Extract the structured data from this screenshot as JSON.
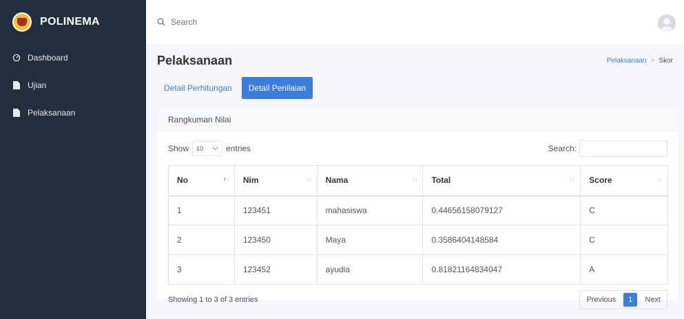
{
  "brand": {
    "name": "POLINEMA",
    "logo_icon": "polinema-logo-icon"
  },
  "sidebar": {
    "items": [
      {
        "label": "Dashboard",
        "icon": "dashboard-icon"
      },
      {
        "label": "Ujian",
        "icon": "file-icon"
      },
      {
        "label": "Pelaksanaan",
        "icon": "file-icon"
      }
    ]
  },
  "topbar": {
    "search_placeholder": "Search",
    "avatar_icon": "user-avatar"
  },
  "page": {
    "title": "Pelaksanaan",
    "breadcrumb": {
      "link": "Pelaksanaan",
      "separator": ">",
      "current": "Skor"
    }
  },
  "tabs": [
    {
      "label": "Detail Perhitungan",
      "active": false
    },
    {
      "label": "Detail Penilaian",
      "active": true
    }
  ],
  "card": {
    "header": "Rangkuman Nilai",
    "length": {
      "show": "Show",
      "value": "10",
      "entries": "entries"
    },
    "search_label": "Search:",
    "columns": [
      "No",
      "Nim",
      "Nama",
      "Total",
      "Score"
    ],
    "rows": [
      [
        "1",
        "123451",
        "mahasiswa",
        "0.44656158079127",
        "C"
      ],
      [
        "2",
        "123450",
        "Maya",
        "0.3586404148584",
        "C"
      ],
      [
        "3",
        "123452",
        "ayudia",
        "0.81821164834047",
        "A"
      ]
    ],
    "info": "Showing 1 to 3 of 3 entries",
    "pagination": {
      "previous": "Previous",
      "current": "1",
      "next": "Next"
    }
  },
  "colors": {
    "sidebar_bg": "#222e3c",
    "accent": "#3b7ddd",
    "page_bg": "#f4f6f9"
  }
}
